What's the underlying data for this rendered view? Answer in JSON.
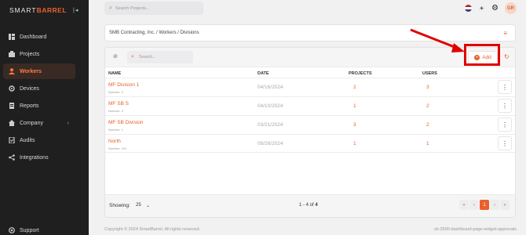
{
  "brand": {
    "name_part1": "SMART",
    "name_part2": "BARREL",
    "collapse_icon": "collapse-icon"
  },
  "sidebar": {
    "items": [
      {
        "label": "Dashboard",
        "icon": "dashboard-icon"
      },
      {
        "label": "Projects",
        "icon": "projects-icon"
      },
      {
        "label": "Workers",
        "icon": "workers-icon",
        "active": true
      },
      {
        "label": "Devices",
        "icon": "devices-icon"
      },
      {
        "label": "Reports",
        "icon": "reports-icon"
      },
      {
        "label": "Company",
        "icon": "company-icon"
      },
      {
        "label": "Audits",
        "icon": "audits-icon"
      },
      {
        "label": "Integrations",
        "icon": "integrations-icon"
      }
    ],
    "support": "Support"
  },
  "topbar": {
    "search_placeholder": "Search Projects...",
    "avatar_initials": "GR"
  },
  "breadcrumb": "SMB Contracting, Inc.  /  Workers  /  Divisions",
  "toolbar": {
    "search_placeholder": "Search...",
    "add_label": "Add"
  },
  "table": {
    "headers": {
      "name": "NAME",
      "date": "DATE",
      "projects": "PROJECTS",
      "users": "USERS"
    },
    "rows": [
      {
        "name": "MF Division 1",
        "number": "Number: 4",
        "date": "04/16/2024",
        "projects": "2",
        "users": "3"
      },
      {
        "name": "MF SB S",
        "number": "Number: 3",
        "date": "04/10/2024",
        "projects": "1",
        "users": "2"
      },
      {
        "name": "MF SB Division",
        "number": "Number: 1",
        "date": "03/21/2024",
        "projects": "3",
        "users": "2"
      },
      {
        "name": "North",
        "number": "Number: 101",
        "date": "08/26/2024",
        "projects": "1",
        "users": "1"
      }
    ]
  },
  "footer": {
    "showing_label": "Showing:",
    "page_size": "25",
    "range_text": "1 - 4 of ",
    "range_total": "4",
    "current_page": "1"
  },
  "copyright": "Copyright © 2024 SmartBarrel. All rights reserved.",
  "build": "zb-2690-dashboard-page-widget-approvals",
  "colors": {
    "accent": "#e8612c",
    "sidebar_bg": "#1f1f1f",
    "annotation_red": "#e00000"
  }
}
